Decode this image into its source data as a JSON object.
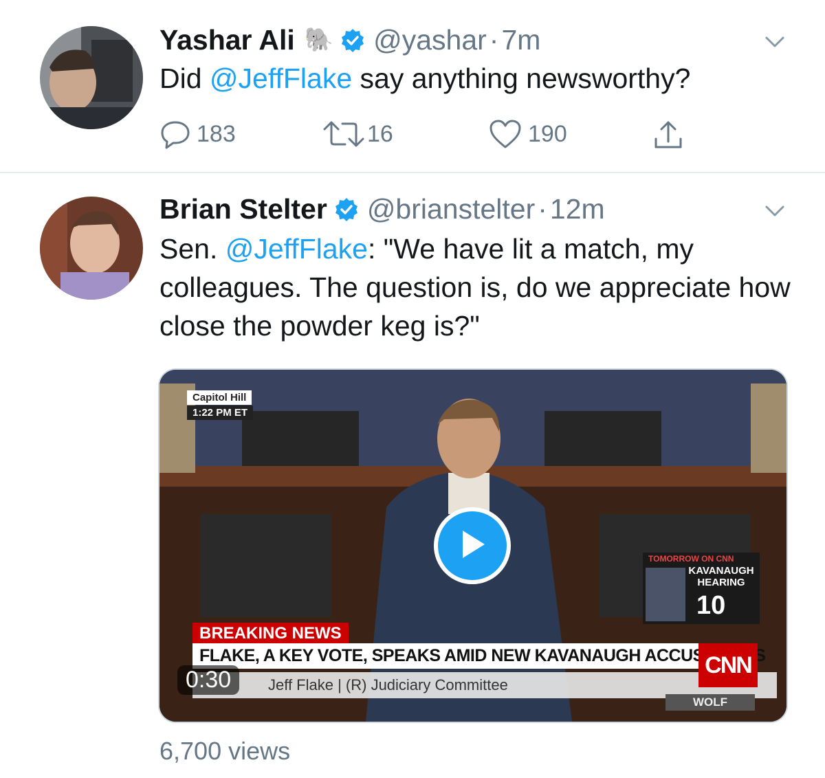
{
  "tweets": [
    {
      "name": "Yashar Ali",
      "emoji": "🐘",
      "handle": "@yashar",
      "time": "7m",
      "text_prefix": "Did ",
      "mention": "@JeffFlake",
      "text_suffix": " say anything newsworthy?",
      "replies": "183",
      "retweets": "16",
      "likes": "190",
      "verified": true
    },
    {
      "name": "Brian Stelter",
      "handle": "@brianstelter",
      "time": "12m",
      "text_prefix": "Sen. ",
      "mention": "@JeffFlake",
      "text_suffix": ": \"We have lit a match, my colleagues. The question is, do we appreciate how close the powder keg is?\"",
      "verified": true,
      "video": {
        "duration": "0:30",
        "bug_location": "Capitol Hill",
        "bug_time": "1:22 PM ET",
        "breaking_label": "BREAKING NEWS",
        "headline": "FLAKE, A KEY VOTE, SPEAKS AMID NEW KAVANAUGH ACCUSATIONS",
        "subline": "Jeff Flake  |  (R) Judiciary Committee",
        "network": "CNN",
        "show": "WOLF",
        "promo_head": "TOMORROW ON CNN",
        "promo_title": "KAVANAUGH HEARING",
        "promo_time": "10"
      },
      "views": "6,700 views"
    }
  ],
  "colors": {
    "link": "#1da1f2",
    "muted": "#657786",
    "text": "#14171a",
    "divider": "#e6ecf0"
  }
}
